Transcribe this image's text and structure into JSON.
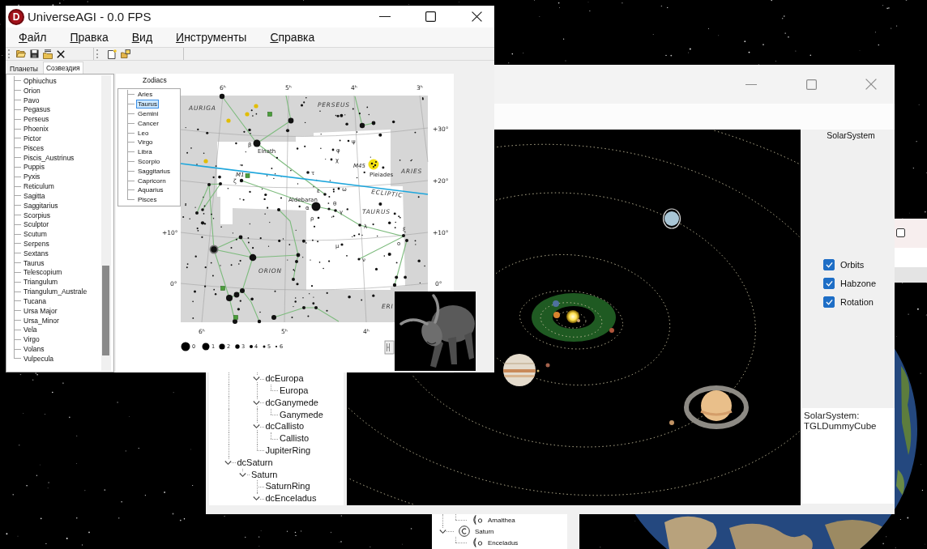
{
  "main_window": {
    "logo_letter": "D",
    "title": "UniverseAGI - 0.0 FPS",
    "menu": [
      "Файл",
      "Правка",
      "Вид",
      "Инструменты",
      "Справка"
    ],
    "tabs": [
      {
        "label": "Планеты",
        "selected": false
      },
      {
        "label": "Созвездия",
        "selected": true
      }
    ],
    "constellations": [
      "Ophiuchus",
      "Orion",
      "Pavo",
      "Pegasus",
      "Perseus",
      "Phoenix",
      "Pictor",
      "Pisces",
      "Piscis_Austrinus",
      "Puppis",
      "Pyxis",
      "Reticulum",
      "Sagitta",
      "Saggitarius",
      "Scorpius",
      "Sculptor",
      "Scutum",
      "Serpens",
      "Sextans",
      "Taurus",
      "Telescopium",
      "Triangulum",
      "Triangulum_Australe",
      "Tucana",
      "Ursa Major",
      "Ursa_Minor",
      "Vela",
      "Virgo",
      "Volans",
      "Vulpecula"
    ],
    "zodiacs": {
      "caption": "Zodiacs",
      "items": [
        {
          "label": "Aries",
          "selected": false
        },
        {
          "label": "Taurus",
          "selected": true
        },
        {
          "label": "Gemini",
          "selected": false
        },
        {
          "label": "Cancer",
          "selected": false
        },
        {
          "label": "Leo",
          "selected": false
        },
        {
          "label": "Virgo",
          "selected": false
        },
        {
          "label": "Libra",
          "selected": false
        },
        {
          "label": "Scorpio",
          "selected": false
        },
        {
          "label": "Saggitarius",
          "selected": false
        },
        {
          "label": "Capricorn",
          "selected": false
        },
        {
          "label": "Aquarius",
          "selected": false
        },
        {
          "label": "Pisces",
          "selected": false
        }
      ]
    },
    "star_chart": {
      "ra_top": [
        "6ʰ",
        "5ʰ",
        "4ʰ",
        "3ʰ"
      ],
      "ra_bottom": [
        "6ʰ",
        "5ʰ",
        "4ʰ"
      ],
      "dec_right": [
        "+30°",
        "+20°",
        "+10°",
        "0°"
      ],
      "dec_left": [
        "+10°",
        "0°"
      ],
      "area_labels": [
        "AURIGA",
        "PERSEUS",
        "ARIES",
        "ECLIPTIC",
        "TAURUS",
        "ORION",
        "ERI"
      ],
      "object_labels": [
        "Elnath",
        "M1",
        "M45",
        "Pleiades",
        "Aldebaran"
      ],
      "greek_labels": [
        "β",
        "ζ",
        "τ",
        "ψ",
        "φ",
        "χ",
        "ω",
        "ε",
        "α",
        "θ",
        "γ",
        "ρ",
        "λ",
        "ξ",
        "ο",
        "μ",
        "ν"
      ],
      "magnitudes": [
        "0",
        "1",
        "2",
        "3",
        "4",
        "5",
        "6"
      ]
    }
  },
  "solar_window": {
    "tree": [
      {
        "children": [
          {
            "children": [
              {
                "label": "dcEuropa",
                "expanded": true,
                "children": [
                  {
                    "label": "Europa"
                  }
                ]
              },
              {
                "label": "dcGanymede",
                "expanded": true,
                "children": [
                  {
                    "label": "Ganymede"
                  }
                ]
              },
              {
                "label": "dcCallisto",
                "expanded": true,
                "children": [
                  {
                    "label": "Callisto"
                  }
                ]
              },
              {
                "label": "JupiterRing"
              }
            ]
          }
        ]
      },
      {
        "label": "dcSaturn",
        "expanded": true,
        "children": [
          {
            "label": "Saturn",
            "expanded": true,
            "children": [
              {
                "label": "SaturnRing"
              },
              {
                "label": "dcEnceladus",
                "expanded": true
              }
            ]
          }
        ]
      }
    ],
    "panel": {
      "title": "SolarSystem",
      "options": [
        {
          "label": "Orbits",
          "checked": true
        },
        {
          "label": "Habzone",
          "checked": true
        },
        {
          "label": "Rotation",
          "checked": true
        }
      ],
      "info": "SolarSystem: TGLDummyCube"
    }
  },
  "back_window": {
    "tree": [
      {
        "children": [
          {
            "label": "Amalthea",
            "kind": "moon"
          }
        ]
      },
      {
        "label": "Saturn",
        "kind": "planet",
        "expanded": true,
        "children": [
          {
            "label": "Enceladus",
            "kind": "moon"
          }
        ]
      }
    ]
  },
  "side_window": {
    "checkbox": {
      "checked": false
    }
  }
}
